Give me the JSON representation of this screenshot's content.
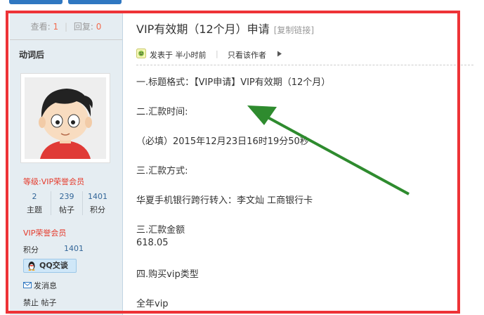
{
  "sidebar": {
    "views_label": "查看:",
    "views_value": "1",
    "replies_label": "回复:",
    "replies_value": "0",
    "username": "动词后",
    "level": "等级:VIP荣誉会员",
    "counts": [
      {
        "value": "2",
        "label": "主题"
      },
      {
        "value": "239",
        "label": "帖子"
      },
      {
        "value": "1401",
        "label": "积分"
      }
    ],
    "vip_title": "VIP荣誉会员",
    "points_label": "积分",
    "points_value": "1401",
    "qq_button": "QQ交谈",
    "send_message": "发消息",
    "ban_post": "禁止 帖子"
  },
  "post": {
    "title": "VIP有效期（12个月）申请",
    "copy_link": "[复制链接]",
    "posted_time": "发表于 半小时前",
    "divider": "|",
    "only_author": "只看该作者",
    "lines": [
      "一.标题格式：【VIP申请】VIP有效期（12个月）",
      "二.汇款时间:",
      "（必填）2015年12月23日16时19分50秒",
      "三.汇款方式:",
      "华夏手机银行跨行转入：李文灿 工商银行卡",
      "三.汇款金额",
      "618.05",
      "四.购买vip类型",
      "全年vip"
    ]
  },
  "annotation": {
    "frame_color": "#ee3337",
    "arrow_color": "#2e8b2e"
  }
}
